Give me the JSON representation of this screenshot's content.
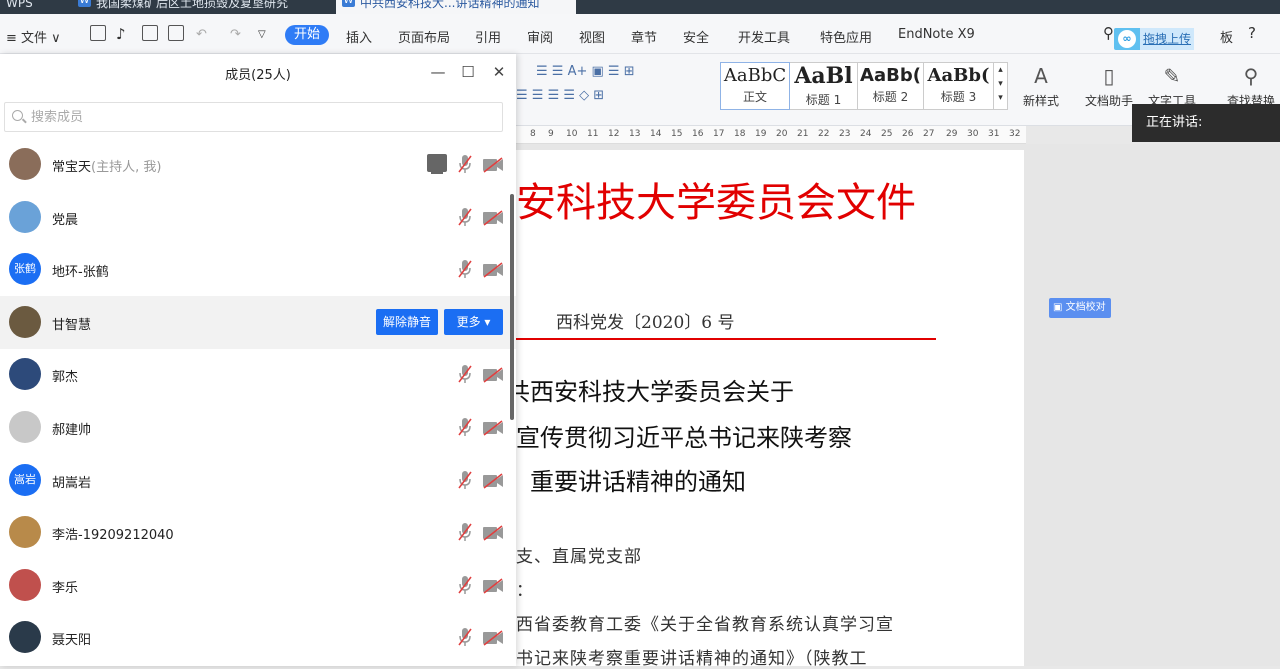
{
  "tabs": [
    {
      "label": "WPS",
      "active": false
    },
    {
      "label": "我国柔煤矿后区土地损毁及复垦研究",
      "active": false
    },
    {
      "label": "中共西安科技大...讲话精神的通知",
      "active": true
    }
  ],
  "menu": {
    "file_label": "文件",
    "start_label": "开始",
    "items": [
      "插入",
      "页面布局",
      "引用",
      "审阅",
      "视图",
      "章节",
      "安全",
      "开发工具",
      "特色应用",
      "EndNote X9"
    ],
    "upload_label": "拖拽上传",
    "pad_label": "板"
  },
  "ribbon": {
    "styles": [
      {
        "sample": "AaBbC",
        "name": "正文"
      },
      {
        "sample": "AaBl",
        "name": "标题 1"
      },
      {
        "sample": "AaBb(",
        "name": "标题 2"
      },
      {
        "sample": "AaBb(",
        "name": "标题 3"
      }
    ],
    "tools": [
      "新样式",
      "文档助手",
      "文字工具",
      "查找替换"
    ]
  },
  "ruler_marks": [
    "8",
    "9",
    "10",
    "11",
    "12",
    "13",
    "14",
    "15",
    "16",
    "17",
    "18",
    "19",
    "20",
    "21",
    "22",
    "23",
    "24",
    "25",
    "26",
    "27",
    "29",
    "30",
    "31",
    "32"
  ],
  "document": {
    "red_title": "安科技大学委员会文件",
    "doc_number": "西科党发〔2020〕6 号",
    "heading_lines": [
      "共西安科技大学委员会关于",
      "宣传贯彻习近平总书记来陕考察",
      "重要讲话精神的通知"
    ],
    "body_lines": [
      "支、直属党支部",
      "：",
      "西省委教育工委《关于全省教育系统认真学习宣",
      "书记来陕考察重要讲话精神的通知》（陕教工"
    ]
  },
  "check_label": "文档校对",
  "speaking_label": "正在讲话:",
  "panel": {
    "title": "成员(25人)",
    "search_placeholder": "搜索成员",
    "unmute_label": "解除静音",
    "more_label": "更多",
    "members": [
      {
        "name": "常宝天",
        "role": "(主持人, 我)",
        "avatar": "",
        "avatar_color": "#8a6d5a"
      },
      {
        "name": "党晨",
        "role": "",
        "avatar": "",
        "avatar_color": "#6aa2d8"
      },
      {
        "name": "地环-张鹤",
        "role": "",
        "avatar": "张鹤",
        "avatar_color": "#1b6ef3"
      },
      {
        "name": "甘智慧",
        "role": "",
        "avatar": "",
        "avatar_color": "#6b5a40"
      },
      {
        "name": "郭杰",
        "role": "",
        "avatar": "",
        "avatar_color": "#2d4a7a"
      },
      {
        "name": "郝建帅",
        "role": "",
        "avatar": "",
        "avatar_color": "#c8c8c8"
      },
      {
        "name": "胡嵩岩",
        "role": "",
        "avatar": "嵩岩",
        "avatar_color": "#1b6ef3"
      },
      {
        "name": "李浩-19209212040",
        "role": "",
        "avatar": "",
        "avatar_color": "#b88a4a"
      },
      {
        "name": "李乐",
        "role": "",
        "avatar": "",
        "avatar_color": "#c0504d"
      },
      {
        "name": "聂天阳",
        "role": "",
        "avatar": "",
        "avatar_color": "#2a3a4a"
      }
    ]
  }
}
